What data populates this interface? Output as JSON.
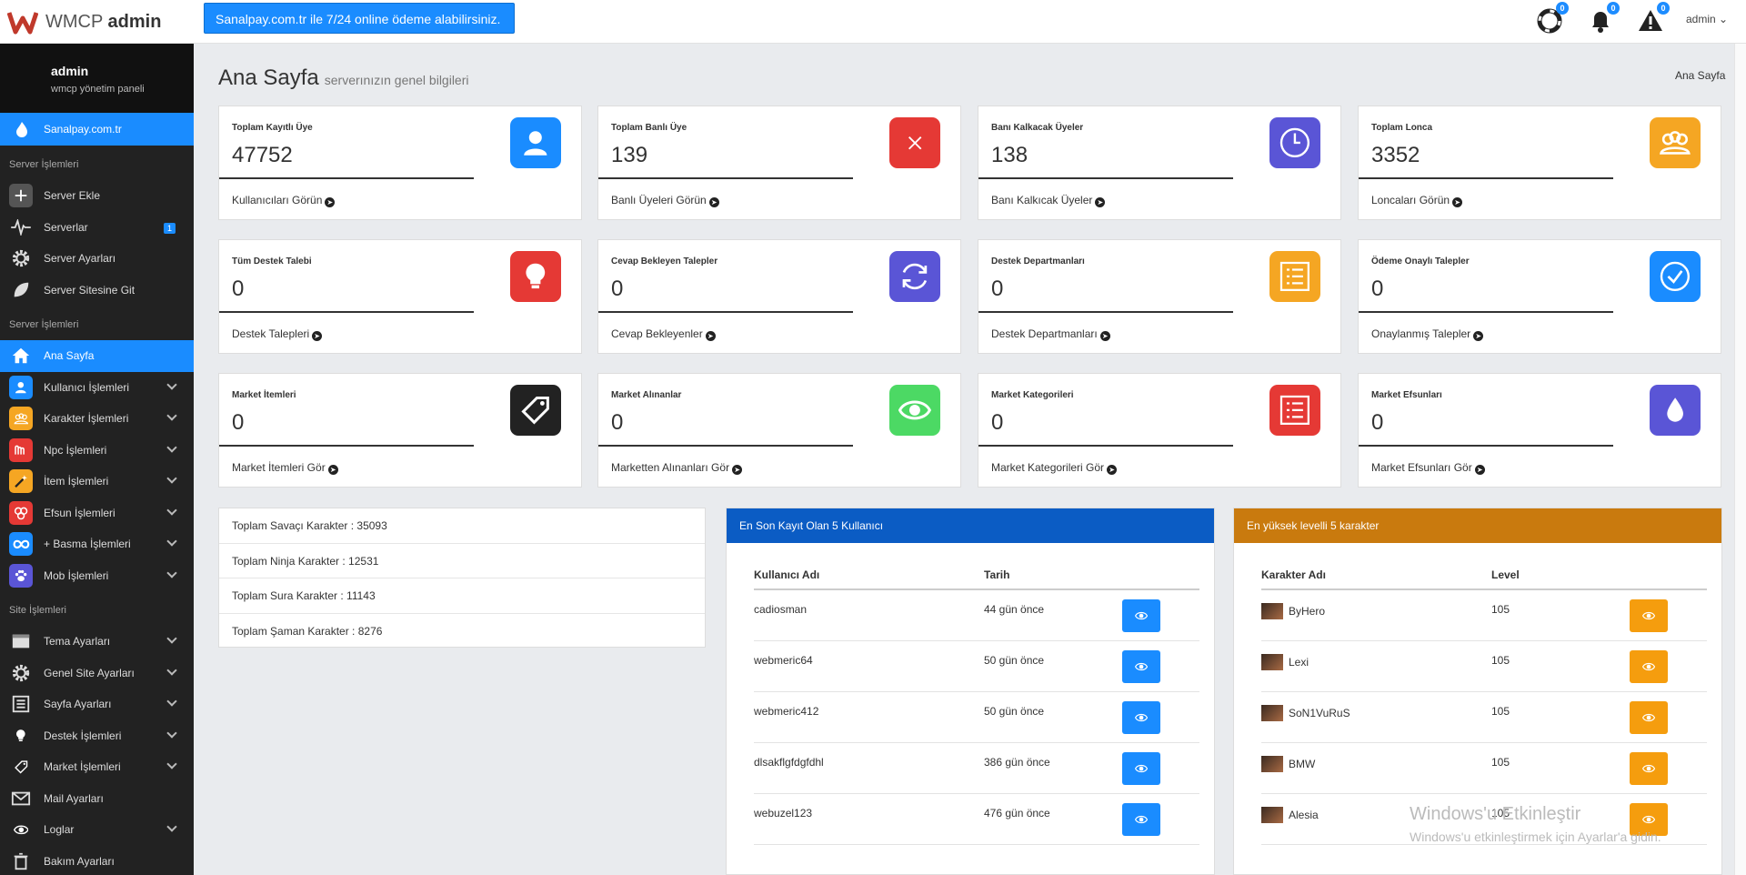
{
  "header": {
    "brand_light": "WMCP",
    "brand_bold": "admin",
    "banner": "Sanalpay.com.tr ile 7/24 online ödeme alabilirsiniz.",
    "icons": [
      {
        "name": "lifebuoy-icon",
        "badge": "0"
      },
      {
        "name": "bell-icon",
        "badge": "0"
      },
      {
        "name": "warning-icon",
        "badge": "0"
      }
    ],
    "user": "admin"
  },
  "sidebar": {
    "profile_name": "admin",
    "profile_sub": "wmcp yönetim paneli",
    "sanalpay": "Sanalpay.com.tr",
    "sections": [
      {
        "title": "Server İşlemleri",
        "items": [
          {
            "label": "Server Ekle",
            "icon": "plus-icon",
            "color": "#555"
          },
          {
            "label": "Serverlar",
            "icon": "pulse-icon",
            "color": "transparent",
            "badge": "1"
          },
          {
            "label": "Server Ayarları",
            "icon": "gear-icon",
            "color": "transparent"
          },
          {
            "label": "Server Sitesine Git",
            "icon": "leaf-icon",
            "color": "transparent"
          }
        ]
      },
      {
        "title": "Server İşlemleri",
        "items": [
          {
            "label": "Ana Sayfa",
            "icon": "home-icon",
            "color": "transparent",
            "active": true
          },
          {
            "label": "Kullanıcı İşlemleri",
            "icon": "user-icon",
            "color": "#1a8cff",
            "chevron": true
          },
          {
            "label": "Karakter İşlemleri",
            "icon": "group-icon",
            "color": "#f5a623",
            "chevron": true
          },
          {
            "label": "Npc İşlemleri",
            "icon": "npc-icon",
            "color": "#e53935",
            "chevron": true
          },
          {
            "label": "İtem İşlemleri",
            "icon": "wand-icon",
            "color": "#f5a623",
            "chevron": true
          },
          {
            "label": "Efsun İşlemleri",
            "icon": "efsun-icon",
            "color": "#e53935",
            "chevron": true
          },
          {
            "label": "+ Basma İşlemleri",
            "icon": "infinity-icon",
            "color": "#1a8cff",
            "chevron": true
          },
          {
            "label": "Mob İşlemleri",
            "icon": "paw-icon",
            "color": "#5a55d6",
            "chevron": true
          }
        ]
      },
      {
        "title": "Site İşlemleri",
        "items": [
          {
            "label": "Tema Ayarları",
            "icon": "window-icon",
            "color": "transparent",
            "chevron": true
          },
          {
            "label": "Genel Site Ayarları",
            "icon": "gear-icon",
            "color": "transparent",
            "chevron": true
          },
          {
            "label": "Sayfa Ayarları",
            "icon": "page-icon",
            "color": "transparent",
            "chevron": true
          },
          {
            "label": "Destek İşlemleri",
            "icon": "bulb-icon",
            "color": "transparent",
            "chevron": true
          },
          {
            "label": "Market İşlemleri",
            "icon": "tag-icon",
            "color": "transparent",
            "chevron": true
          },
          {
            "label": "Mail Ayarları",
            "icon": "mail-icon",
            "color": "transparent"
          },
          {
            "label": "Loglar",
            "icon": "eye-icon",
            "color": "transparent",
            "chevron": true
          },
          {
            "label": "Bakım Ayarları",
            "icon": "trash-icon",
            "color": "transparent"
          }
        ]
      }
    ]
  },
  "page": {
    "title": "Ana Sayfa",
    "subtitle": "serverınızın genel bilgileri",
    "breadcrumb": "Ana Sayfa"
  },
  "cards": [
    {
      "label": "Toplam Kayıtlı Üye",
      "value": "47752",
      "link": "Kullanıcıları Görün",
      "icon": "user-icon",
      "color": "#1a8cff"
    },
    {
      "label": "Toplam Banlı Üye",
      "value": "139",
      "link": "Banlı Üyeleri Görün",
      "icon": "close-icon",
      "color": "#e53935"
    },
    {
      "label": "Banı Kalkacak Üyeler",
      "value": "138",
      "link": "Banı Kalkıcak Üyeler",
      "icon": "clock-icon",
      "color": "#5a55d6"
    },
    {
      "label": "Toplam Lonca",
      "value": "3352",
      "link": "Loncaları Görün",
      "icon": "group-icon",
      "color": "#f5a623"
    },
    {
      "label": "Tüm Destek Talebi",
      "value": "0",
      "link": "Destek Talepleri",
      "icon": "bulb-icon",
      "color": "#e53935"
    },
    {
      "label": "Cevap Bekleyen Talepler",
      "value": "0",
      "link": "Cevap Bekleyenler",
      "icon": "refresh-icon",
      "color": "#5a55d6"
    },
    {
      "label": "Destek Departmanları",
      "value": "0",
      "link": "Destek Departmanları",
      "icon": "list-icon",
      "color": "#f5a623"
    },
    {
      "label": "Ödeme Onaylı Talepler",
      "value": "0",
      "link": "Onaylanmış Talepler",
      "icon": "check-icon",
      "color": "#1a8cff"
    },
    {
      "label": "Market İtemleri",
      "value": "0",
      "link": "Market İtemleri Gör",
      "icon": "tag-icon",
      "color": "#222222"
    },
    {
      "label": "Market Alınanlar",
      "value": "0",
      "link": "Marketten Alınanları Gör",
      "icon": "eye-icon",
      "color": "#4cd964"
    },
    {
      "label": "Market Kategorileri",
      "value": "0",
      "link": "Market Kategorileri Gör",
      "icon": "list-icon",
      "color": "#e53935"
    },
    {
      "label": "Market Efsunları",
      "value": "0",
      "link": "Market Efsunları Gör",
      "icon": "drop-icon",
      "color": "#5a55d6"
    }
  ],
  "totals": [
    "Toplam Savaçı Karakter : 35093",
    "Toplam Ninja Karakter : 12531",
    "Toplam Sura Karakter : 11143",
    "Toplam Şaman Karakter : 8276"
  ],
  "latest_users": {
    "title": "En Son Kayıt Olan 5 Kullanıcı",
    "header_color": "#0b5cc4",
    "col1": "Kullanıcı Adı",
    "col2": "Tarih",
    "btn_color": "#1a8cff",
    "rows": [
      {
        "name": "cadiosman",
        "date": "44 gün önce"
      },
      {
        "name": "webmeric64",
        "date": "50 gün önce"
      },
      {
        "name": "webmeric412",
        "date": "50 gün önce"
      },
      {
        "name": "dlsakflgfdgfdhl",
        "date": "386 gün önce"
      },
      {
        "name": "webuzel123",
        "date": "476 gün önce"
      }
    ]
  },
  "top_chars": {
    "title": "En yüksek levelli 5 karakter",
    "header_color": "#c97a0e",
    "col1": "Karakter Adı",
    "col2": "Level",
    "btn_color": "#f59d0e",
    "rows": [
      {
        "name": "ByHero",
        "level": "105"
      },
      {
        "name": "Lexi",
        "level": "105"
      },
      {
        "name": "SoN1VuRuS",
        "level": "105"
      },
      {
        "name": "BMW",
        "level": "105"
      },
      {
        "name": "Alesia",
        "level": "105"
      }
    ]
  },
  "watermark": {
    "line1": "Windows'u Etkinleştir",
    "line2": "Windows'u etkinleştirmek için Ayarlar'a gidin."
  }
}
